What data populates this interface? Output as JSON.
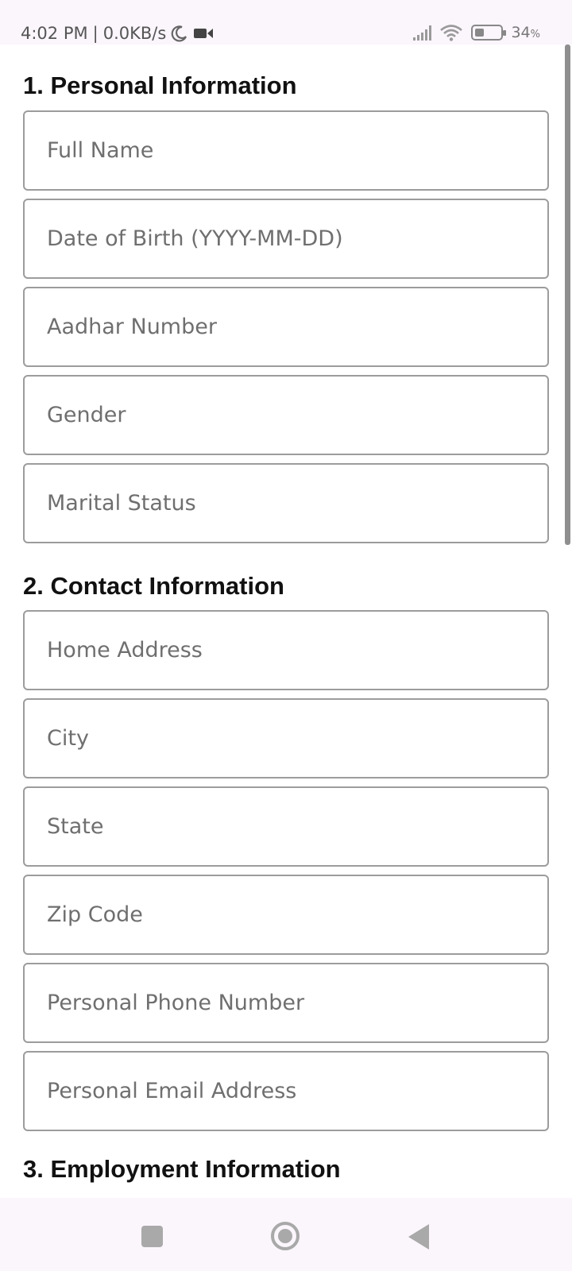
{
  "status_bar": {
    "time": "4:02 PM",
    "speed": "0.0KB/s",
    "separator": "|",
    "battery_level": "34",
    "battery_unit": "%"
  },
  "sections": {
    "personal": {
      "title": "1. Personal Information",
      "fields": {
        "full_name": "Full Name",
        "dob": "Date of Birth (YYYY-MM-DD)",
        "aadhar": "Aadhar Number",
        "gender": "Gender",
        "marital": "Marital Status"
      }
    },
    "contact": {
      "title": "2. Contact Information",
      "fields": {
        "address": "Home Address",
        "city": "City",
        "state": "State",
        "zip": "Zip Code",
        "phone": "Personal Phone Number",
        "email": "Personal Email Address"
      }
    },
    "employment": {
      "title": "3. Employment Information"
    }
  }
}
